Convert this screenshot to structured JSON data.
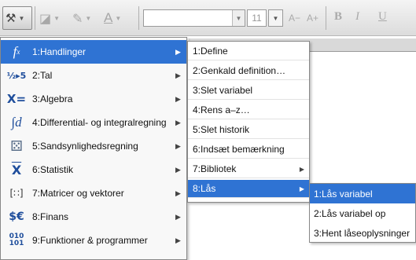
{
  "toolbar": {
    "font_size_value": "11",
    "decrease_size_label": "A−",
    "increase_size_label": "A+",
    "bold_label": "B",
    "italic_label": "I",
    "underline_label": "U"
  },
  "menu_main": {
    "items": [
      {
        "label": "1:Handlinger",
        "icon": "function-icon",
        "icon_text": "fₐ"
      },
      {
        "label": "2:Tal",
        "icon": "fraction-icon",
        "icon_text": "½▸5"
      },
      {
        "label": "3:Algebra",
        "icon": "x-equals-icon",
        "icon_text": "X="
      },
      {
        "label": "4:Differential- og integralregning",
        "icon": "integral-icon",
        "icon_text": "∫d"
      },
      {
        "label": "5:Sandsynlighedsregning",
        "icon": "dice-icon",
        "icon_text": "⚄"
      },
      {
        "label": "6:Statistik",
        "icon": "x-bar-icon",
        "icon_text": "X̅"
      },
      {
        "label": "7:Matricer og vektorer",
        "icon": "matrix-icon",
        "icon_text": "[∷]"
      },
      {
        "label": "8:Finans",
        "icon": "currency-icon",
        "icon_text": "$€"
      },
      {
        "label": "9:Funktioner & programmer",
        "icon": "binary-icon",
        "icon_text": "010"
      }
    ],
    "active_index": 0
  },
  "menu_actions": {
    "items": [
      {
        "label": "1:Define"
      },
      {
        "label": "2:Genkald definition…"
      },
      {
        "label": "3:Slet variabel"
      },
      {
        "label": "4:Rens a–z…"
      },
      {
        "label": "5:Slet historik"
      },
      {
        "label": "6:Indsæt bemærkning"
      },
      {
        "label": "7:Bibliotek"
      },
      {
        "label": "8:Lås"
      }
    ],
    "active_index": 7
  },
  "menu_lock": {
    "items": [
      {
        "label": "1:Lås variabel"
      },
      {
        "label": "2:Lås variabel op"
      },
      {
        "label": "3:Hent låseoplysninger"
      }
    ],
    "active_index": 0
  },
  "colors": {
    "highlight": "#2f73d3",
    "icon_blue": "#1f4e9c"
  }
}
